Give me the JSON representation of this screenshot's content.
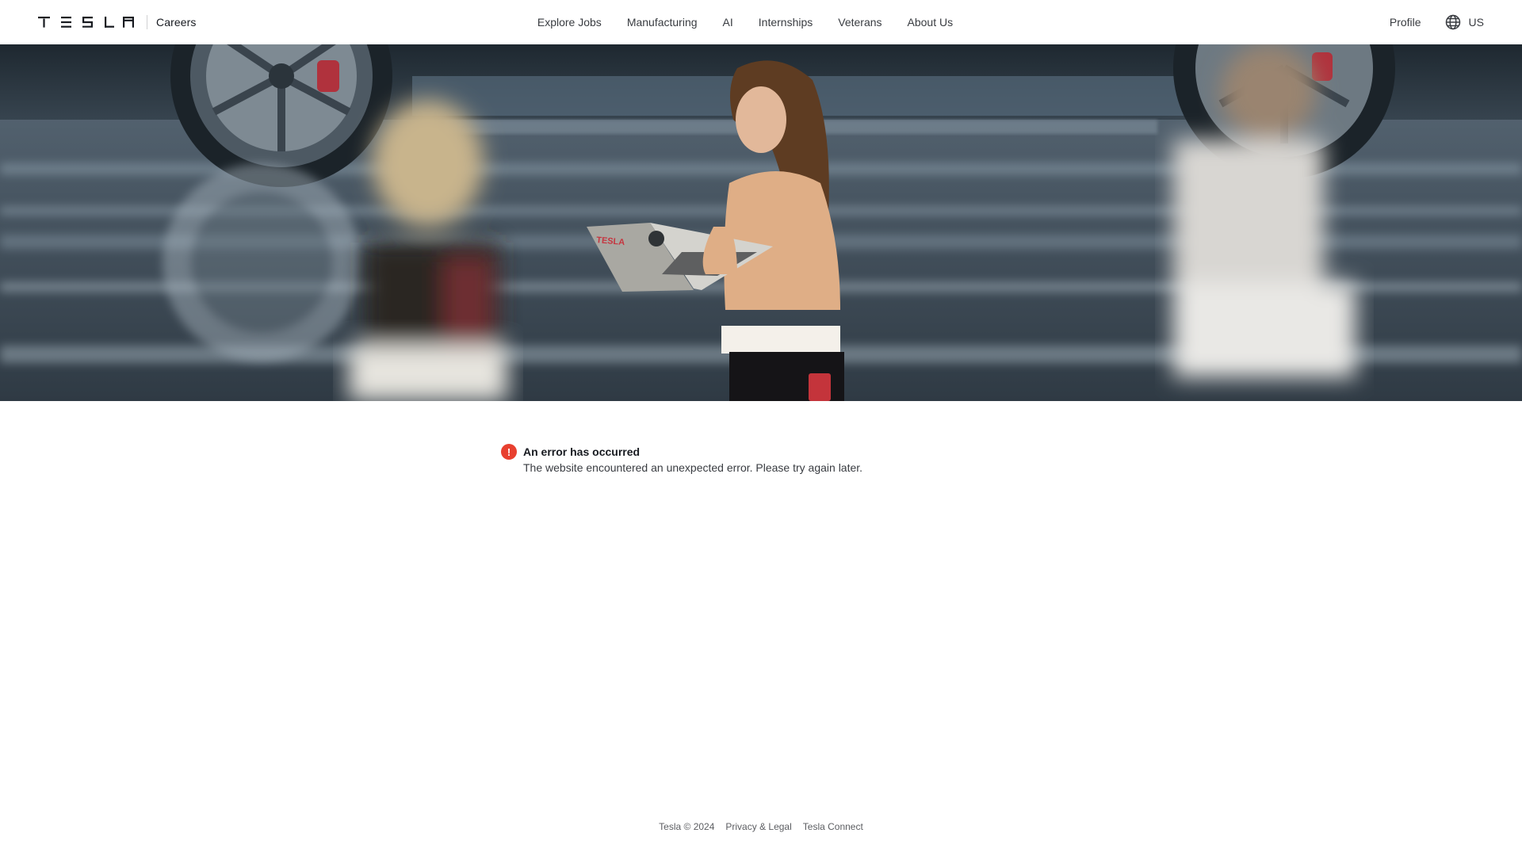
{
  "header": {
    "brand": "TESLA",
    "section_label": "Careers",
    "nav": [
      "Explore Jobs",
      "Manufacturing",
      "AI",
      "Internships",
      "Veterans",
      "About Us"
    ],
    "profile_label": "Profile",
    "region_label": "US"
  },
  "hero": {
    "laptop_text": "TESLA"
  },
  "error": {
    "title": "An error has occurred",
    "message": "The website encountered an unexpected error. Please try again later.",
    "icon_glyph": "!",
    "color": "#e8402f"
  },
  "footer": {
    "copyright": "Tesla © 2024",
    "links": [
      "Privacy & Legal",
      "Tesla Connect"
    ]
  },
  "colors": {
    "text_primary": "#171a20",
    "text_secondary": "#393c41",
    "background": "#ffffff"
  }
}
